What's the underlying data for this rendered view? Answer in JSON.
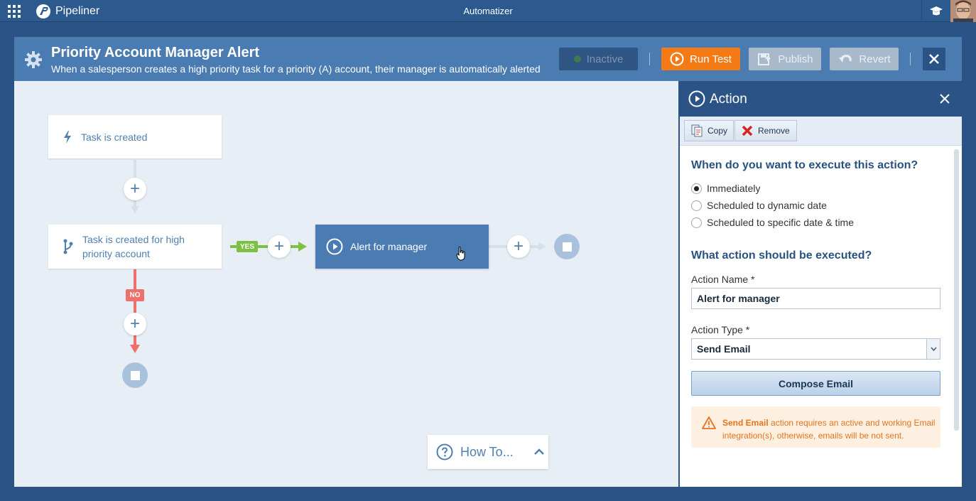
{
  "topbar": {
    "brand": "Pipeliner",
    "app_title": "Automatizer"
  },
  "header": {
    "title": "Priority Account Manager Alert",
    "subtitle": "When a salesperson creates a high priority task for a priority (A) account, their manager is automatically alerted",
    "status_label": "Inactive",
    "run_test_label": "Run Test",
    "publish_label": "Publish",
    "revert_label": "Revert",
    "colors": {
      "run_test": "#f47a16",
      "header": "#4a7bb1"
    }
  },
  "flow": {
    "trigger": {
      "label": "Task is created",
      "icon": "lightning-icon"
    },
    "condition": {
      "label": "Task is created for high priority account",
      "icon": "branch-icon"
    },
    "yes_badge": "YES",
    "no_badge": "NO",
    "action": {
      "label": "Alert for manager",
      "icon": "play-circle-icon"
    },
    "colors": {
      "yes": "#7dc142",
      "no": "#ef6f6c"
    }
  },
  "howto": {
    "label": "How To..."
  },
  "side_panel": {
    "title": "Action",
    "toolbar": {
      "copy_label": "Copy",
      "remove_label": "Remove"
    },
    "when_heading": "When do you want to execute this action?",
    "when_options": [
      {
        "label": "Immediately",
        "selected": true
      },
      {
        "label": "Scheduled to dynamic date",
        "selected": false
      },
      {
        "label": "Scheduled to specific date & time",
        "selected": false
      }
    ],
    "what_heading": "What action should be executed?",
    "action_name_label": "Action Name *",
    "action_name_value": "Alert for manager",
    "action_type_label": "Action Type *",
    "action_type_value": "Send Email",
    "compose_label": "Compose Email",
    "warning_strong": "Send Email",
    "warning_text": " action requires an active and working Email integration(s), otherwise, emails will be not sent."
  }
}
